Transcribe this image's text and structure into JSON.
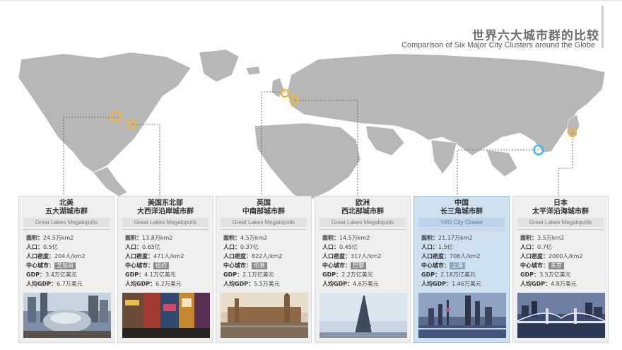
{
  "header": {
    "title_cn": "世界六大城市群的比较",
    "title_en": "Comparison of Six Major City Clusters around the Globe"
  },
  "colors": {
    "map_land": "#b7b7b7",
    "marker_yellow": "#f3b431",
    "marker_blue": "#42bdf0",
    "card_bg": "#efefef",
    "card_highlight": "#cfe0f0"
  },
  "cards": [
    {
      "region": "北美",
      "cluster": "五大湖城市群",
      "en": "Great Lakes Megalopolis",
      "area_label": "面积：",
      "area": "24.5万km2",
      "pop_label": "人口：",
      "pop": "0.5亿",
      "density_label": "人口密度：",
      "density": "204人/km2",
      "center_label": "中心城市：",
      "center": "芝加哥",
      "gdp_label": "GDP：",
      "gdp": "3.4万亿美元",
      "pcgdp_label": "人均GDP：",
      "pcgdp": "6.7万美元"
    },
    {
      "region": "美国东北部",
      "cluster": "大西洋沿岸城市群",
      "en": "Great Lakes Megalopolis",
      "area_label": "面积：",
      "area": "13.8万km2",
      "pop_label": "人口：",
      "pop": "0.65亿",
      "density_label": "人口密度：",
      "density": "471人/km2",
      "center_label": "中心城市：",
      "center": "纽约",
      "gdp_label": "GDP：",
      "gdp": "4.1万亿美元",
      "pcgdp_label": "人均GDP：",
      "pcgdp": "6.2万美元"
    },
    {
      "region": "英国",
      "cluster": "中南部城市群",
      "en": "Great Lakes Megalopolis",
      "area_label": "面积：",
      "area": "4.5万km2",
      "pop_label": "人口：",
      "pop": "0.37亿",
      "density_label": "人口密度：",
      "density": "822人/km2",
      "center_label": "中心城市：",
      "center": "伦敦",
      "gdp_label": "GDP：",
      "gdp": "2.1万亿美元",
      "pcgdp_label": "人均GDP：",
      "pcgdp": "5.5万美元"
    },
    {
      "region": "欧洲",
      "cluster": "西北部城市群",
      "en": "Great Lakes Megalopolis",
      "area_label": "面积：",
      "area": "14.5万km2",
      "pop_label": "人口：",
      "pop": "0.45亿",
      "density_label": "人口密度：",
      "density": "317人/km2",
      "center_label": "中心城市：",
      "center": "巴黎",
      "gdp_label": "GDP：",
      "gdp": "2.2万亿美元",
      "pcgdp_label": "人均GDP：",
      "pcgdp": "4.6万美元"
    },
    {
      "region": "中国",
      "cluster": "长三角城市群",
      "en": "YRD City Cluster",
      "area_label": "面积：",
      "area": "21.17万km2",
      "pop_label": "人口：",
      "pop": "1.5亿",
      "density_label": "人口密度：",
      "density": "708人/km2",
      "center_label": "中心城市：",
      "center": "上海",
      "gdp_label": "GDP：",
      "gdp": "2.18万亿美元",
      "pcgdp_label": "人均GDP：",
      "pcgdp": "1.46万美元"
    },
    {
      "region": "日本",
      "cluster": "太平洋沿海城市群",
      "en": "Great Lakes Megalopolis",
      "area_label": "面积：",
      "area": "3.5万km2",
      "pop_label": "人口：",
      "pop": "0.7亿",
      "density_label": "人口密度：",
      "density": "2000人/km2",
      "center_label": "中心城市：",
      "center": "东京",
      "gdp_label": "GDP：",
      "gdp": "3.5万亿美元",
      "pcgdp_label": "人均GDP：",
      "pcgdp": "4.8万美元"
    }
  ]
}
